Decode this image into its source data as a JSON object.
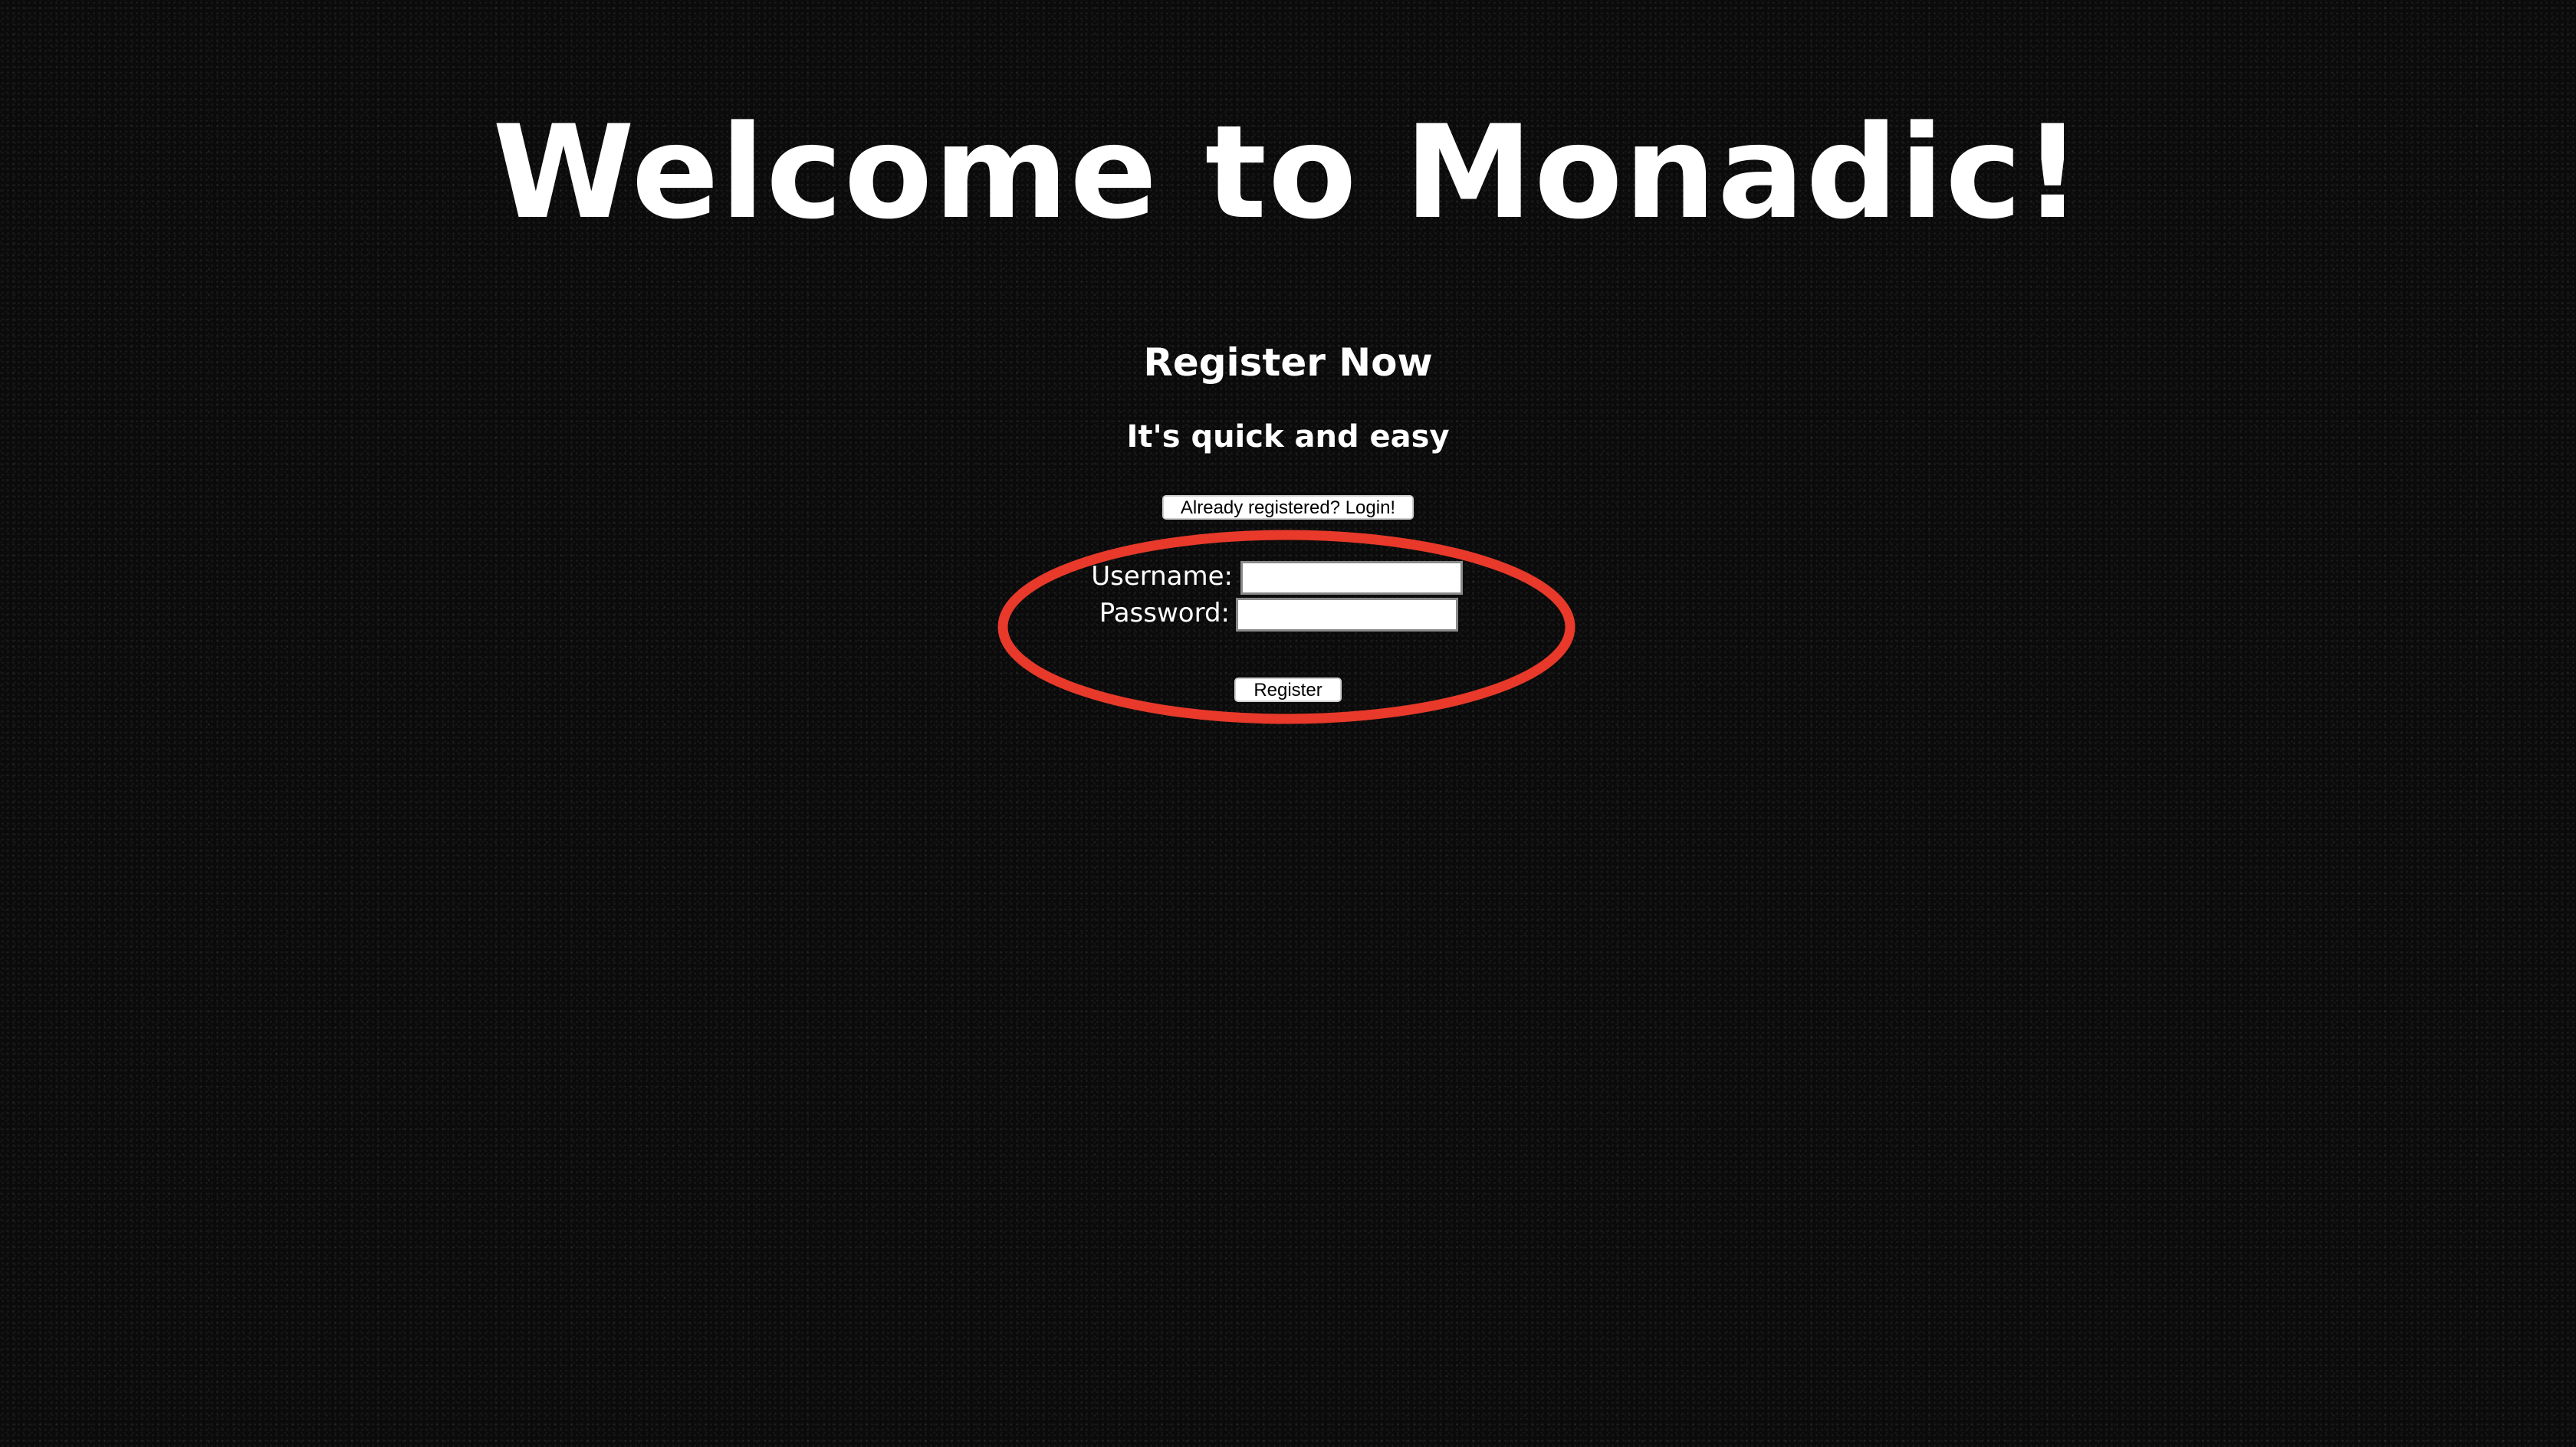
{
  "page": {
    "title": "Welcome to Monadic!",
    "subtitle": "Register Now",
    "tagline": "It's quick and easy"
  },
  "login_button": {
    "label": "Already registered? Login!"
  },
  "form": {
    "username_label": "Username:",
    "username_value": "",
    "password_label": "Password:",
    "password_value": "",
    "submit_label": "Register"
  },
  "annotation": {
    "highlight_color": "#e8392a"
  }
}
